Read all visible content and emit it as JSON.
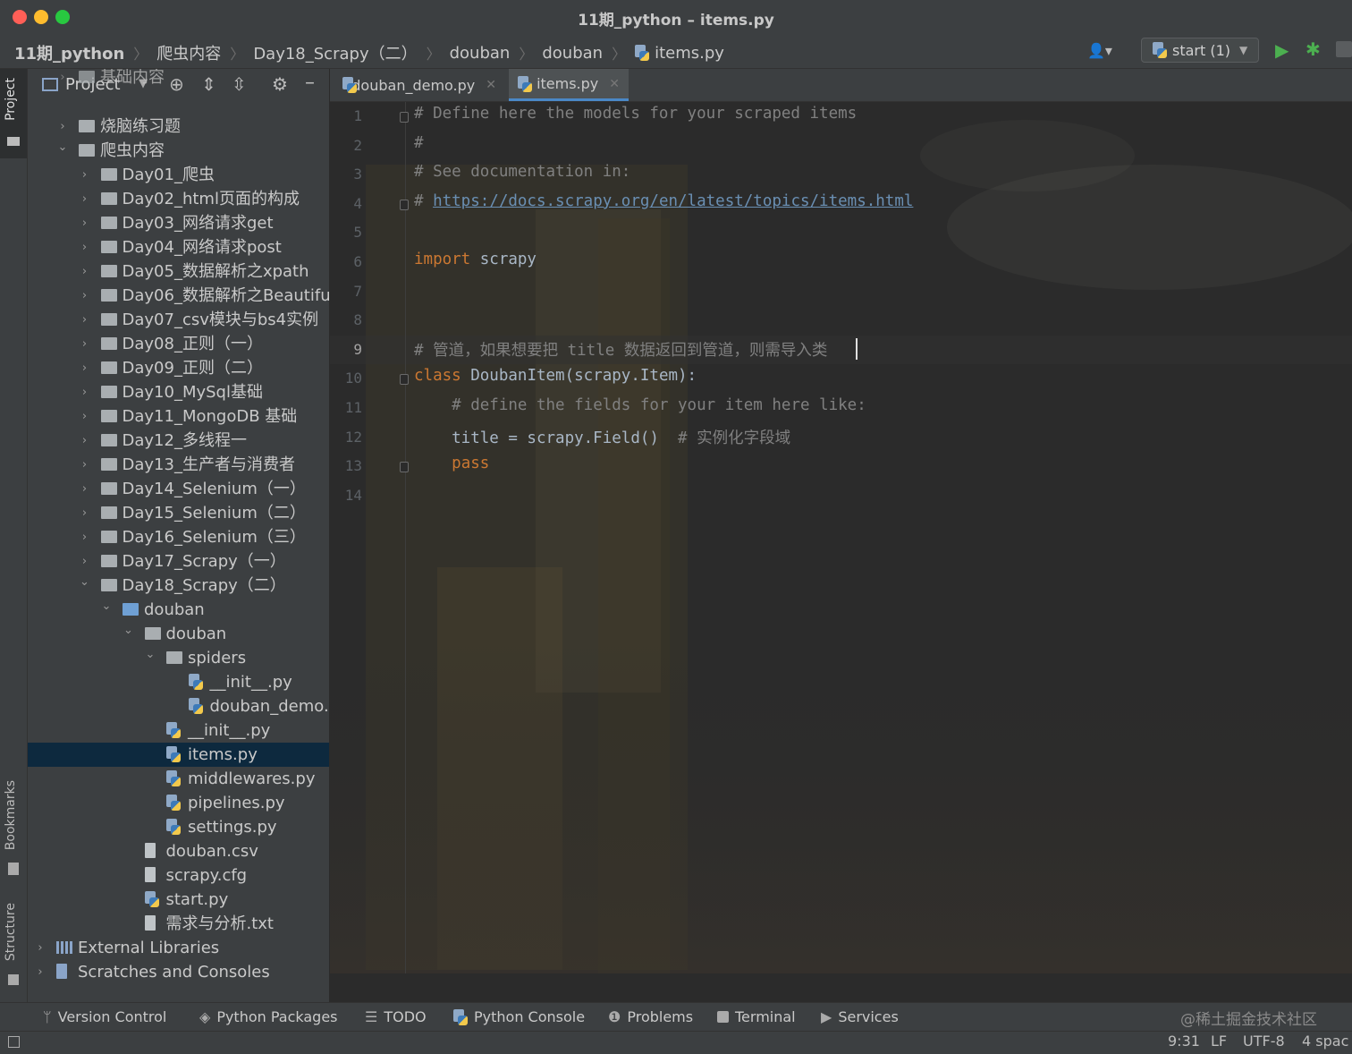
{
  "window": {
    "title": "11期_python – items.py"
  },
  "breadcrumb": [
    "11期_python",
    "爬虫内容",
    "Day18_Scrapy（二）",
    "douban",
    "douban",
    "items.py"
  ],
  "run_config": {
    "label": "start (1)"
  },
  "sidebar": {
    "project_tab": "Project",
    "bookmarks_tab": "Bookmarks",
    "structure_tab": "Structure"
  },
  "project_panel": {
    "title": "Project",
    "tree": [
      {
        "label": "基础内容",
        "indent": 0,
        "type": "folder",
        "state": "collapsed"
      },
      {
        "label": "烧脑练习题",
        "indent": 0,
        "type": "folder",
        "state": "collapsed"
      },
      {
        "label": "爬虫内容",
        "indent": 0,
        "type": "folder",
        "state": "expanded"
      },
      {
        "label": "Day01_爬虫",
        "indent": 1,
        "type": "folder",
        "state": "collapsed"
      },
      {
        "label": "Day02_html页面的构成",
        "indent": 1,
        "type": "folder",
        "state": "collapsed"
      },
      {
        "label": "Day03_网络请求get",
        "indent": 1,
        "type": "folder",
        "state": "collapsed"
      },
      {
        "label": "Day04_网络请求post",
        "indent": 1,
        "type": "folder",
        "state": "collapsed"
      },
      {
        "label": "Day05_数据解析之xpath",
        "indent": 1,
        "type": "folder",
        "state": "collapsed"
      },
      {
        "label": "Day06_数据解析之Beautifu",
        "indent": 1,
        "type": "folder",
        "state": "collapsed"
      },
      {
        "label": "Day07_csv模块与bs4实例",
        "indent": 1,
        "type": "folder",
        "state": "collapsed"
      },
      {
        "label": "Day08_正则（一）",
        "indent": 1,
        "type": "folder",
        "state": "collapsed"
      },
      {
        "label": "Day09_正则（二）",
        "indent": 1,
        "type": "folder",
        "state": "collapsed"
      },
      {
        "label": "Day10_MySql基础",
        "indent": 1,
        "type": "folder",
        "state": "collapsed"
      },
      {
        "label": "Day11_MongoDB 基础",
        "indent": 1,
        "type": "folder",
        "state": "collapsed"
      },
      {
        "label": "Day12_多线程一",
        "indent": 1,
        "type": "folder",
        "state": "collapsed"
      },
      {
        "label": "Day13_生产者与消费者",
        "indent": 1,
        "type": "folder",
        "state": "collapsed"
      },
      {
        "label": "Day14_Selenium（一）",
        "indent": 1,
        "type": "folder",
        "state": "collapsed"
      },
      {
        "label": "Day15_Selenium（二）",
        "indent": 1,
        "type": "folder",
        "state": "collapsed"
      },
      {
        "label": "Day16_Selenium（三）",
        "indent": 1,
        "type": "folder",
        "state": "collapsed"
      },
      {
        "label": "Day17_Scrapy（一）",
        "indent": 1,
        "type": "folder",
        "state": "collapsed"
      },
      {
        "label": "Day18_Scrapy（二）",
        "indent": 1,
        "type": "folder",
        "state": "expanded"
      },
      {
        "label": "douban",
        "indent": 2,
        "type": "folder-blue",
        "state": "expanded"
      },
      {
        "label": "douban",
        "indent": 3,
        "type": "folder",
        "state": "expanded"
      },
      {
        "label": "spiders",
        "indent": 4,
        "type": "folder",
        "state": "expanded"
      },
      {
        "label": "__init__.py",
        "indent": 5,
        "type": "python",
        "state": "leaf"
      },
      {
        "label": "douban_demo.",
        "indent": 5,
        "type": "python",
        "state": "leaf"
      },
      {
        "label": "__init__.py",
        "indent": 4,
        "type": "python",
        "state": "leaf"
      },
      {
        "label": "items.py",
        "indent": 4,
        "type": "python",
        "state": "leaf",
        "selected": true
      },
      {
        "label": "middlewares.py",
        "indent": 4,
        "type": "python",
        "state": "leaf"
      },
      {
        "label": "pipelines.py",
        "indent": 4,
        "type": "python",
        "state": "leaf"
      },
      {
        "label": "settings.py",
        "indent": 4,
        "type": "python",
        "state": "leaf"
      },
      {
        "label": "douban.csv",
        "indent": 3,
        "type": "file",
        "state": "leaf"
      },
      {
        "label": "scrapy.cfg",
        "indent": 3,
        "type": "file",
        "state": "leaf"
      },
      {
        "label": "start.py",
        "indent": 3,
        "type": "python",
        "state": "leaf"
      },
      {
        "label": "需求与分析.txt",
        "indent": 3,
        "type": "file",
        "state": "leaf"
      },
      {
        "label": "External Libraries",
        "indent": -1,
        "type": "library",
        "state": "collapsed"
      },
      {
        "label": "Scratches and Consoles",
        "indent": -1,
        "type": "scratch",
        "state": "collapsed"
      }
    ]
  },
  "editor_tabs": [
    {
      "label": "douban_demo.py",
      "active": false
    },
    {
      "label": "items.py",
      "active": true
    }
  ],
  "code_lines": [
    {
      "n": "1",
      "html": "<span class=\"cm\"># Define here the models for your scraped items</span>"
    },
    {
      "n": "2",
      "html": "<span class=\"cm\">#</span>"
    },
    {
      "n": "3",
      "html": "<span class=\"cm\"># See documentation in:</span>"
    },
    {
      "n": "4",
      "html": "<span class=\"cm\"># <span class=\"url\">https://docs.scrapy.org/en/latest/topics/items.html</span></span>"
    },
    {
      "n": "5",
      "html": ""
    },
    {
      "n": "6",
      "html": "<span class=\"kw\">import</span> scrapy"
    },
    {
      "n": "7",
      "html": ""
    },
    {
      "n": "8",
      "html": ""
    },
    {
      "n": "9",
      "html": "<span class=\"cm\"># 管道，如果想要把 title 数据返回到管道，则需导入类</span>"
    },
    {
      "n": "10",
      "html": "<span class=\"kw\">class</span> DoubanItem(scrapy.Item):"
    },
    {
      "n": "11",
      "html": "    <span class=\"cm\"># define the fields for your item here like:</span>"
    },
    {
      "n": "12",
      "html": "    title = scrapy.Field()  <span class=\"cm\"># 实例化字段域</span>"
    },
    {
      "n": "13",
      "html": "    <span class=\"kw\">pass</span>"
    },
    {
      "n": "14",
      "html": ""
    }
  ],
  "current_line": "9",
  "bottom_tools": [
    "Version Control",
    "Python Packages",
    "TODO",
    "Python Console",
    "Problems",
    "Terminal",
    "Services"
  ],
  "status": {
    "position": "9:31",
    "line_sep": "LF",
    "encoding": "UTF-8",
    "indent": "4 spac"
  },
  "watermark": "@稀土掘金技术社区",
  "colors": {
    "keyword": "#cc7832",
    "comment": "#808080",
    "selection": "#0d293e",
    "run_green": "#4caf50"
  }
}
